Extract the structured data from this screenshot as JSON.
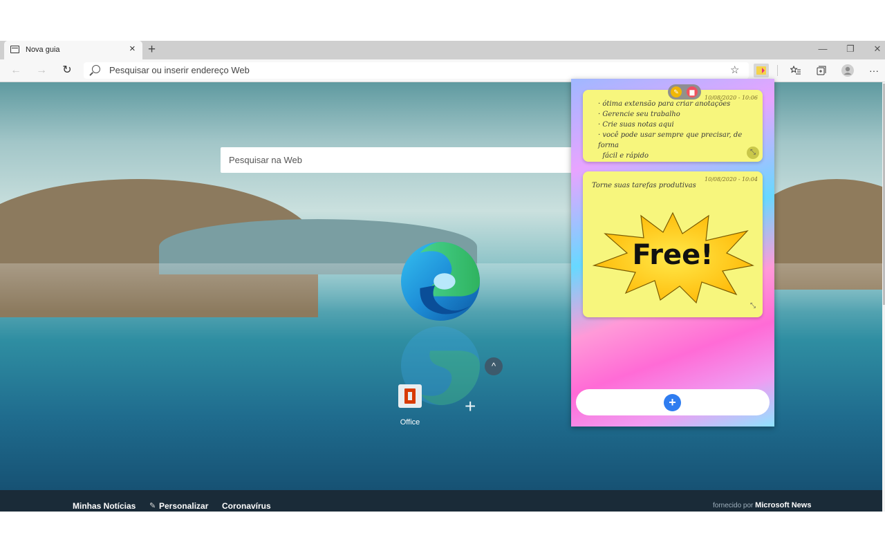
{
  "browser": {
    "tab_title": "Nova guia",
    "tab_close": "×",
    "new_tab": "+",
    "window_controls": {
      "minimize": "—",
      "maximize": "❐",
      "close": "✕"
    },
    "nav": {
      "back": "←",
      "forward": "→",
      "refresh": "↻"
    },
    "address_placeholder": "Pesquisar ou inserir endereço Web",
    "favorite_star": "☆",
    "toolbar_icons": [
      "note-extension-icon",
      "favorites-icon",
      "collections-icon",
      "profile-icon",
      "more-icon"
    ],
    "more": "···"
  },
  "newtab": {
    "search_placeholder": "Pesquisar na Web",
    "collapse": "^",
    "quick_links": [
      {
        "label": "Office"
      }
    ],
    "add_site": "+",
    "news_bar": {
      "links": [
        "Minhas Notícias",
        "Personalizar",
        "Coronavírus"
      ],
      "powered_prefix": "fornecido por ",
      "powered_brand": "Microsoft News"
    }
  },
  "notes_popup": {
    "notes": [
      {
        "date": "10/08/2020 - 10:06",
        "lines": [
          "· ótima extensão para criar anotações",
          "· Gerencie seu trabalho",
          "· Crie suas notas aqui",
          "· você pode usar sempre que precisar, de forma",
          "  fácil e rápido"
        ]
      },
      {
        "date": "10/08/2020 - 10:04",
        "lines": [
          "Torne suas tarefas produtivas"
        ],
        "badge": "Free!"
      }
    ],
    "add_button": "+",
    "accent": "#2f7df0",
    "note_color": "#f7f67d"
  }
}
